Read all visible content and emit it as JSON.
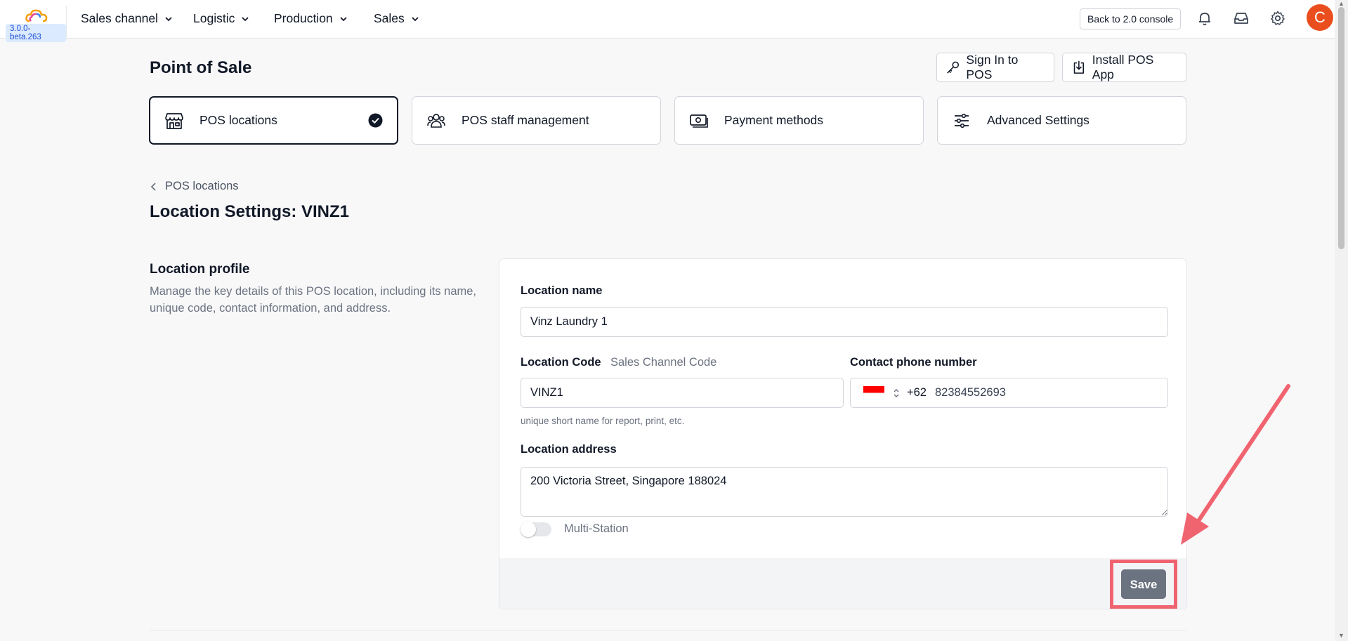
{
  "app": {
    "version": "3.0.0-beta.263"
  },
  "nav": {
    "items": [
      "Sales channel",
      "Logistic",
      "Production",
      "Sales"
    ],
    "console_label": "Back to 2.0 console",
    "avatar_initial": "C"
  },
  "header": {
    "title": "Point of Sale",
    "sign_in_label": "Sign In to POS",
    "install_label": "Install POS App"
  },
  "tabs": [
    {
      "label": "POS locations",
      "active": true
    },
    {
      "label": "POS staff management",
      "active": false
    },
    {
      "label": "Payment methods",
      "active": false
    },
    {
      "label": "Advanced Settings",
      "active": false
    }
  ],
  "breadcrumb": {
    "back_label": "POS locations"
  },
  "section": {
    "title": "Location Settings: VINZ1"
  },
  "profile": {
    "title": "Location profile",
    "description": "Manage the key details of this POS location, including its name, unique code, contact information, and address."
  },
  "form": {
    "name_label": "Location name",
    "name_value": "Vinz Laundry 1",
    "code_label": "Location Code",
    "code_sublabel": "Sales Channel Code",
    "code_value": "VINZ1",
    "code_hint": "unique short name for report, print, etc.",
    "phone_label": "Contact phone number",
    "phone_prefix": "+62",
    "phone_value": "82384552693",
    "address_label": "Location address",
    "address_value": "200 Victoria Street, Singapore 188024",
    "multistation_label": "Multi-Station",
    "multistation_on": false,
    "save_label": "Save"
  },
  "colors": {
    "accent_avatar": "#ea4e1e",
    "annotation": "#f06470",
    "save_button": "#6b7280"
  }
}
